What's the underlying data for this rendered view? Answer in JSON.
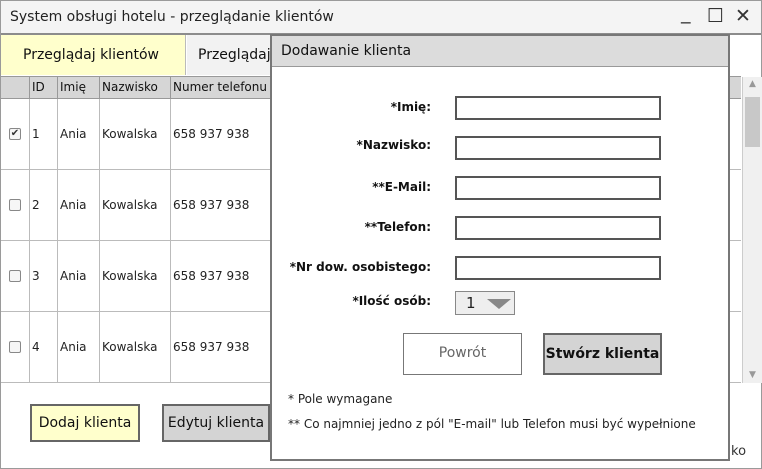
{
  "window": {
    "title": "System obsługi hotelu - przeglądanie klientów",
    "minimize": "_",
    "maximize": "☐",
    "close": "✕"
  },
  "tabs": [
    {
      "label": "Przeglądaj klientów",
      "active": true
    },
    {
      "label": "Przeglądaj",
      "active": false
    }
  ],
  "table": {
    "columns": [
      "ID",
      "Imię",
      "Nazwisko",
      "Numer telefonu"
    ],
    "rows": [
      {
        "checked": true,
        "id": "1",
        "first_name": "Ania",
        "last_name": "Kowalska",
        "phone": "658 937 938"
      },
      {
        "checked": false,
        "id": "2",
        "first_name": "Ania",
        "last_name": "Kowalska",
        "phone": "658 937 938"
      },
      {
        "checked": false,
        "id": "3",
        "first_name": "Ania",
        "last_name": "Kowalska",
        "phone": "658 937 938"
      },
      {
        "checked": false,
        "id": "4",
        "first_name": "Ania",
        "last_name": "Kowalska",
        "phone": "658 937 938"
      }
    ]
  },
  "actions": {
    "add_client": "Dodaj klienta",
    "edit_client": "Edytuj klienta",
    "partial_text": "ko"
  },
  "dialog": {
    "title": "Dodawanie klienta",
    "fields": [
      {
        "label": "*Imię:",
        "value": ""
      },
      {
        "label": "*Nazwisko:",
        "value": ""
      },
      {
        "label": "**E-Mail:",
        "value": ""
      },
      {
        "label": "**Telefon:",
        "value": ""
      },
      {
        "label": "*Nr dow. osobistego:",
        "value": ""
      }
    ],
    "guests_label": "*Ilość osób:",
    "guests_value": "1",
    "back_button": "Powrót",
    "create_button": "Stwórz klienta",
    "note_required": "* Pole wymagane",
    "note_contact": "** Co najmniej jedno z pól \"E-mail\" lub Telefon musi być wypełnione"
  },
  "colors": {
    "active_tab": "#ffffcc",
    "button_highlight": "#ffffcc",
    "button_gray": "#d4d4d4",
    "header_gray": "#d6d6d6"
  }
}
